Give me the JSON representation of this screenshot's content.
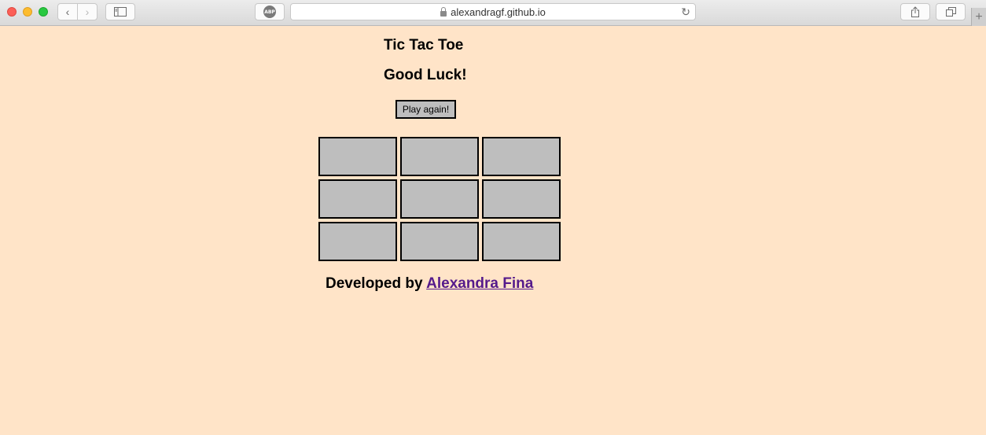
{
  "browser": {
    "url": "alexandragf.github.io",
    "abp_label": "ABP"
  },
  "page": {
    "title": "Tic Tac Toe",
    "status": "Good Luck!",
    "play_again_label": "Play again!",
    "board": [
      "",
      "",
      "",
      "",
      "",
      "",
      "",
      "",
      ""
    ],
    "footer_prefix": "Developed by ",
    "footer_link": "Alexandra Fina"
  },
  "colors": {
    "background": "#ffe4c8",
    "cell_fill": "#bebebe",
    "link": "#551a8b"
  }
}
